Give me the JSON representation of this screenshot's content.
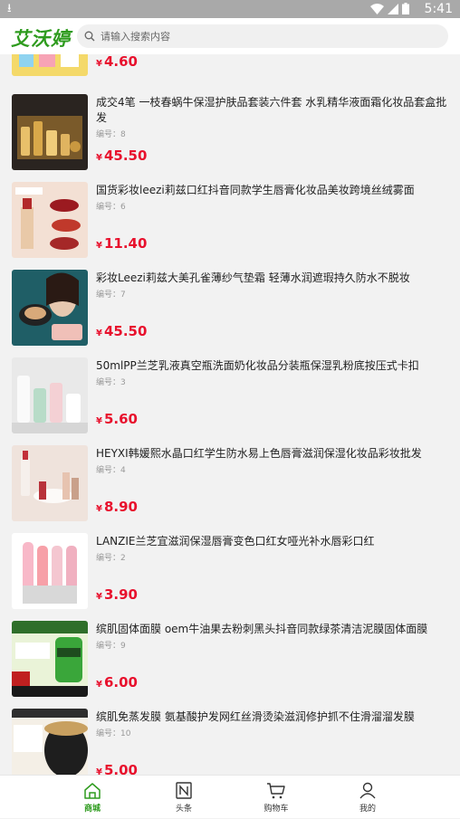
{
  "status_bar": {
    "time": "5:41"
  },
  "header": {
    "logo": "艾沃婷",
    "search_placeholder": "请输入搜索内容"
  },
  "top_partial": {
    "price": "4.60"
  },
  "products": [
    {
      "title": "成交4笔 一枝春蜗牛保湿护肤品套装六件套 水乳精华液面霜化妆品套盒批发",
      "code": "编号：8",
      "price": "45.50"
    },
    {
      "title": "国货彩妆leezi莉兹口红抖音同款学生唇膏化妆品美妆跨境丝绒雾面",
      "code": "编号：6",
      "price": "11.40"
    },
    {
      "title": "彩妆Leezi莉兹大美孔雀薄纱气垫霜 轻薄水润遮瑕持久防水不脱妆",
      "code": "编号：7",
      "price": "45.50"
    },
    {
      "title": "50mlPP兰芝乳液真空瓶洗面奶化妆品分装瓶保湿乳粉底按压式卡扣",
      "code": "编号：3",
      "price": "5.60"
    },
    {
      "title": "HEYXI韩媛熙水晶口红学生防水易上色唇膏滋润保湿化妆品彩妆批发",
      "code": "编号：4",
      "price": "8.90"
    },
    {
      "title": "LANZIE兰芝宜滋润保湿唇膏变色口红女哑光补水唇彩口红",
      "code": "编号：2",
      "price": "3.90"
    },
    {
      "title": "缤肌固体面膜 oem牛油果去粉刺黑头抖音同款绿茶清洁泥膜固体面膜",
      "code": "编号：9",
      "price": "6.00"
    },
    {
      "title": "缤肌免蒸发膜 氨基酸护发网红丝滑烫染滋润修护抓不住滑溜溜发膜",
      "code": "编号：10",
      "price": "5.00"
    }
  ],
  "currency": "¥",
  "tabs": [
    {
      "label": "商城"
    },
    {
      "label": "头条"
    },
    {
      "label": "购物车"
    },
    {
      "label": "我的"
    }
  ],
  "colors": {
    "brand": "#2e9b1e",
    "price": "#e8112d"
  }
}
